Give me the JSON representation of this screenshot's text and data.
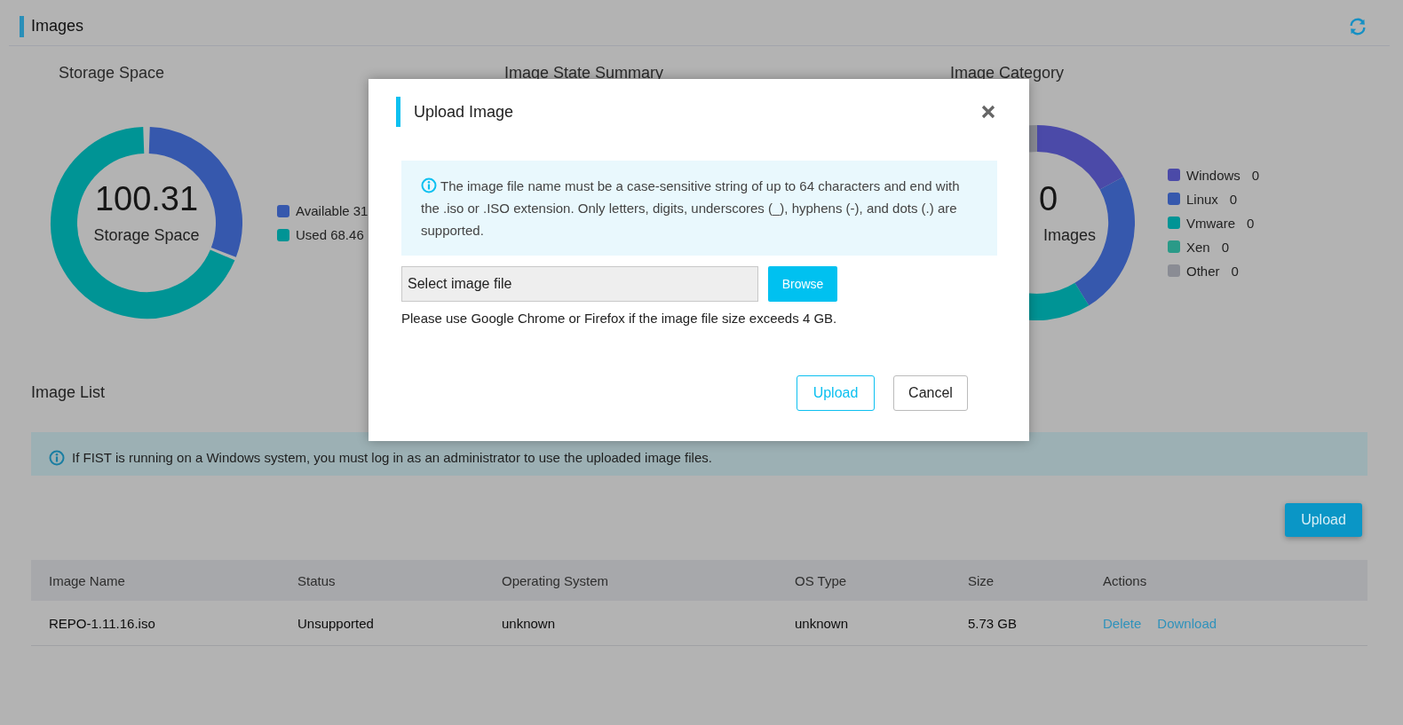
{
  "page": {
    "title": "Images"
  },
  "charts": [
    {
      "kind": "storage",
      "title": "Storage Space",
      "center_value": "100.31",
      "center_label": "Storage Space",
      "legend": [
        {
          "label": "Available 31",
          "color": "#3658ad"
        },
        {
          "label": "Used 68.46",
          "color": "#009495"
        }
      ]
    },
    {
      "kind": "state",
      "title": "Image State Summary"
    },
    {
      "kind": "category",
      "title": "Image Category",
      "center_value": "0",
      "center_label": "Images",
      "legend": [
        {
          "label": "Windows",
          "value": "0",
          "color": "#4b4aa8"
        },
        {
          "label": "Linux",
          "value": "0",
          "color": "#3658ad"
        },
        {
          "label": "Vmware",
          "value": "0",
          "color": "#009495"
        },
        {
          "label": "Xen",
          "value": "0",
          "color": "#2a9a88"
        },
        {
          "label": "Other",
          "value": "0",
          "color": "#8a8c94"
        }
      ]
    }
  ],
  "image_list": {
    "title": "Image List",
    "notice": "If FIST is running on a Windows system, you must log in as an administrator to use the uploaded image files.",
    "upload_button": "Upload",
    "columns": [
      "Image Name",
      "Status",
      "Operating System",
      "OS Type",
      "Size",
      "Actions"
    ],
    "rows": [
      {
        "cells": [
          "REPO-1.11.16.iso",
          "Unsupported",
          "unknown",
          "unknown",
          "5.73 GB"
        ],
        "actions": [
          "Delete",
          "Download"
        ]
      }
    ]
  },
  "dialog": {
    "title": "Upload Image",
    "info": "The image file name must be a case-sensitive string of up to 64 characters and end with the .iso or .ISO extension. Only letters, digits, underscores (_), hyphens (-), and dots (.) are supported.",
    "file_field": {
      "placeholder": "Select image file"
    },
    "browse_button": "Browse",
    "note": "Please use Google Chrome or Firefox if the image file size exceeds 4 GB.",
    "buttons": [
      {
        "label": "Upload",
        "kind": "primary"
      },
      {
        "label": "Cancel",
        "kind": "default"
      }
    ]
  }
}
